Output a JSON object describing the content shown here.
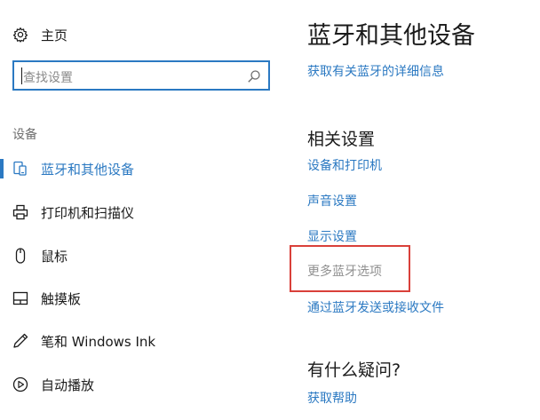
{
  "sidebar": {
    "home_label": "主页",
    "search_placeholder": "查找设置",
    "section_label": "设备",
    "items": [
      {
        "label": "蓝牙和其他设备",
        "icon": "bluetooth-devices-icon",
        "selected": true
      },
      {
        "label": "打印机和扫描仪",
        "icon": "printer-icon",
        "selected": false
      },
      {
        "label": "鼠标",
        "icon": "mouse-icon",
        "selected": false
      },
      {
        "label": "触摸板",
        "icon": "touchpad-icon",
        "selected": false
      },
      {
        "label": "笔和 Windows Ink",
        "icon": "pen-icon",
        "selected": false
      },
      {
        "label": "自动播放",
        "icon": "autoplay-icon",
        "selected": false
      }
    ]
  },
  "main": {
    "title": "蓝牙和其他设备",
    "bluetooth_info_link": "获取有关蓝牙的详细信息",
    "related_heading": "相关设置",
    "related_links": [
      {
        "label": "设备和打印机",
        "enabled": true
      },
      {
        "label": "声音设置",
        "enabled": true
      },
      {
        "label": "显示设置",
        "enabled": true
      },
      {
        "label": "更多蓝牙选项",
        "enabled": false,
        "highlighted": true
      },
      {
        "label": "通过蓝牙发送或接收文件",
        "enabled": true
      }
    ],
    "questions_heading": "有什么疑问?",
    "help_link": "获取帮助"
  },
  "colors": {
    "accent": "#2b79c2",
    "highlight_border": "#d9403a",
    "muted_text": "#8f8f8f"
  }
}
